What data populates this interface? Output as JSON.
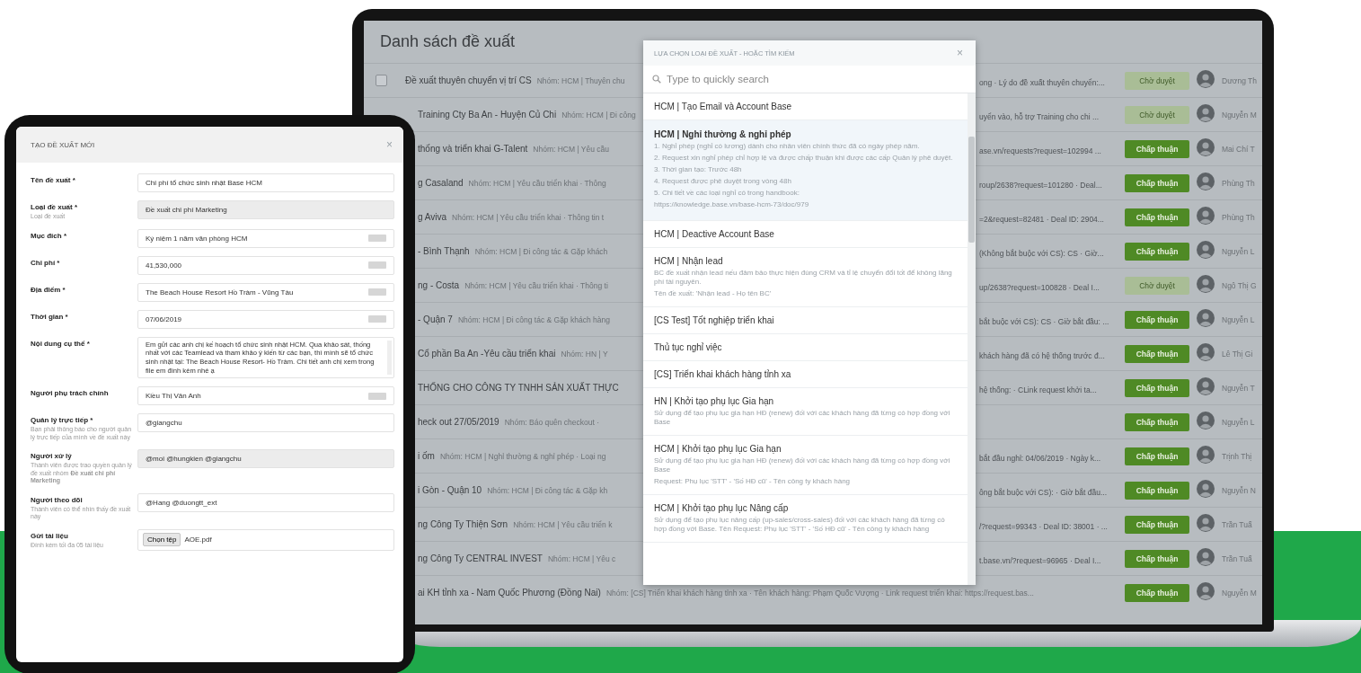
{
  "laptop": {
    "title": "Danh sách đề xuất",
    "rows": [
      {
        "checked": false,
        "title": "Đề xuất thuyên chuyển vị trí CS",
        "meta": "Nhóm: HCM | Thuyên chu",
        "detail": "ong · Lý do đề xuất thuyên chuyển:...",
        "kind": "pending",
        "status_label": "Chờ duyệt",
        "name": "Dương Th"
      },
      {
        "title": "Training Cty Ba An - Huyện Củ Chi",
        "meta": "Nhóm: HCM | Đi công",
        "detail": "uyển vào, hỗ trợ Training cho chi ...",
        "kind": "pending",
        "status_label": "Chờ duyệt",
        "name": "Nguyễn M"
      },
      {
        "title": "thống và triển khai G-Talent",
        "meta": "Nhóm: HCM | Yêu cầu",
        "detail": "ase.vn/requests?request=102994 ...",
        "kind": "approved",
        "status_label": "Chấp thuận",
        "name": "Mai Chí T"
      },
      {
        "title": "g Casaland",
        "meta": "Nhóm: HCM | Yêu cầu triển khai · Thông",
        "detail": "roup/2638?request=101280 · Deal...",
        "kind": "approved",
        "status_label": "Chấp thuận",
        "name": "Phùng Th"
      },
      {
        "title": "g Aviva",
        "meta": "Nhóm: HCM | Yêu cầu triển khai · Thông tin t",
        "detail": "=2&request=82481 · Deal ID: 2904...",
        "kind": "approved",
        "status_label": "Chấp thuận",
        "name": "Phùng Th"
      },
      {
        "title": "- Bình Thạnh",
        "meta": "Nhóm: HCM | Đi công tác & Gặp khách",
        "detail": "(Không bắt buộc với CS): CS · Giờ...",
        "kind": "approved",
        "status_label": "Chấp thuận",
        "name": "Nguyễn L"
      },
      {
        "title": "ng - Costa",
        "meta": "Nhóm: HCM | Yêu cầu triển khai · Thông ti",
        "detail": "up/2638?request=100828 · Deal I...",
        "kind": "pending",
        "status_label": "Chờ duyệt",
        "name": "Ngô Thị G"
      },
      {
        "title": "- Quận 7",
        "meta": "Nhóm: HCM | Đi công tác & Gặp khách hàng",
        "detail": "bắt buộc với CS): CS · Giờ bắt đầu: ...",
        "kind": "approved",
        "status_label": "Chấp thuận",
        "name": "Nguyễn L"
      },
      {
        "title": "Cổ phần Ba An -Yêu cầu triển khai",
        "meta": "Nhóm: HN | Y",
        "detail": "khách hàng đã có hệ thống trước đ...",
        "kind": "approved",
        "status_label": "Chấp thuận",
        "name": "Lê Thị Gi"
      },
      {
        "title": "THỐNG CHO CÔNG TY TNHH SẢN XUẤT THỰC",
        "detail": "hệ thống: · CLink request khởi ta...",
        "kind": "approved",
        "status_label": "Chấp thuận",
        "name": "Nguyễn T"
      },
      {
        "title": "heck out 27/05/2019",
        "meta": "Nhóm: Báo quên checkout ·",
        "kind": "approved",
        "status_label": "Chấp thuận",
        "name": "Nguyễn L"
      },
      {
        "title": "i ốm",
        "meta": "Nhóm: HCM | Nghỉ thường & nghỉ phép · Loại ng",
        "detail": "bắt đầu nghỉ: 04/06/2019 · Ngày k...",
        "kind": "approved",
        "status_label": "Chấp thuận",
        "name": "Trịnh Thị"
      },
      {
        "title": "i Gòn - Quận 10",
        "meta": "Nhóm: HCM | Đi công tác & Gặp kh",
        "detail": "ông bắt buộc với CS): · Giờ bắt đầu...",
        "kind": "approved",
        "status_label": "Chấp thuận",
        "name": "Nguyễn N"
      },
      {
        "title": "ng Công Ty Thiện Sơn",
        "meta": "Nhóm: HCM | Yêu cầu triển k",
        "detail": "/?request=99343 · Deal ID: 38001 · ...",
        "kind": "approved",
        "status_label": "Chấp thuận",
        "name": "Trần Tuấ"
      },
      {
        "title": "ng Công Ty CENTRAL INVEST",
        "meta": "Nhóm: HCM | Yêu c",
        "detail": "t.base.vn/?request=96965 · Deal I...",
        "kind": "approved",
        "status_label": "Chấp thuận",
        "name": "Trần Tuấ"
      },
      {
        "title": "ai KH tỉnh xa - Nam Quốc Phương (Đồng Nai)",
        "meta": "Nhóm: [CS] Triển khai khách hàng tỉnh xa · Tên khách hàng: Phạm Quốc Vượng · Link request triển khai: https://request.bas...",
        "kind": "approved",
        "status_label": "Chấp thuận",
        "name": "Nguyễn M"
      }
    ]
  },
  "modal": {
    "title": "LỰA CHỌN LOẠI ĐỀ XUẤT - HOẶC TÌM KIẾM",
    "close": "×",
    "search": {
      "placeholder": "Type to quickly search"
    },
    "items": [
      {
        "title": "HCM | Tạo Email và Account Base",
        "selected": false
      },
      {
        "title": "HCM | Nghỉ thường & nghỉ phép",
        "selected": true,
        "description": [
          "1. Nghỉ phép (nghỉ có lương) dành cho nhân viên chính thức đã có ngày phép năm.",
          "2. Request xin nghỉ phép chỉ hợp lệ và được chấp thuận khi được các cấp Quản lý phê duyệt.",
          "3. Thời gian tạo: Trước 48h",
          "4. Request được phê duyệt trong vòng 48h",
          "5. Chi tiết về các loại nghỉ có trong handbook:",
          "https://knowledge.base.vn/base-hcm-73/doc/979"
        ]
      },
      {
        "title": "HCM | Deactive Account Base",
        "selected": false
      },
      {
        "title": "HCM | Nhận lead",
        "selected": false,
        "description": [
          "BC đề xuất nhận lead nếu đảm bảo thực hiện đúng CRM và tỉ lệ chuyển đổi tốt để không lãng phí tài nguyên.",
          "Tên đề xuất: 'Nhận lead - Họ tên BC'"
        ]
      },
      {
        "title": "[CS Test] Tốt nghiệp triển khai",
        "selected": false
      },
      {
        "title": "Thủ tục nghỉ việc",
        "selected": false
      },
      {
        "title": "[CS] Triển khai khách hàng tỉnh xa",
        "selected": false
      },
      {
        "title": "HN | Khởi tạo phụ lục Gia hạn",
        "selected": false,
        "description": [
          "Sử dụng để tạo phụ lục gia hạn HĐ (renew) đối với các khách hàng đã từng có hợp đồng với Base"
        ]
      },
      {
        "title": "HCM | Khởi tạo phụ lục Gia hạn",
        "selected": false,
        "description": [
          "Sử dụng để tạo phụ lục gia hạn HĐ (renew) đối với các khách hàng đã từng có hợp đồng với Base",
          "Request: Phụ lục 'STT' - 'Số HĐ cũ' - Tên công ty khách hàng"
        ]
      },
      {
        "title": "HCM | Khởi tạo phụ lục Nâng cấp",
        "selected": false,
        "description": [
          "Sử dụng để tạo phụ lục nâng cấp (up-sales/cross-sales) đối với các khách hàng đã từng có hợp đồng với Base. Tên Request: Phụ lục 'STT' - 'Số HĐ cũ' - Tên công ty khách hàng"
        ]
      }
    ]
  },
  "tablet": {
    "title": "TẠO ĐỀ XUẤT MỚI",
    "close": "×",
    "fields": [
      {
        "label": "Tên đề xuất *",
        "kind": "text",
        "value": "Chi phí tổ chức sinh nhật Base HCM",
        "tag": false
      },
      {
        "label": "Loại đề xuất *",
        "hint": "Loại đề xuất",
        "kind": "disabled",
        "value": "Đề xuất chi phí Marketing",
        "tag": false
      },
      {
        "label": "Mục đích *",
        "kind": "text",
        "value": "Kỷ niệm 1 năm văn phòng HCM",
        "tag": true
      },
      {
        "label": "Chi phí *",
        "kind": "text",
        "value": "41,530,000",
        "tag": true
      },
      {
        "label": "Địa điểm *",
        "kind": "text",
        "value": "The Beach House Resort Hồ Tràm - Vũng Tàu",
        "tag": true
      },
      {
        "label": "Thời gian *",
        "kind": "text",
        "value": "07/06/2019",
        "tag": true
      },
      {
        "label": "Nội dung cụ thể *",
        "kind": "textarea",
        "value": "Em gửi các anh chị kế hoạch tổ chức sinh nhật HCM. Qua khảo sát, thống nhất với các Teamlead và tham khảo ý kiến từ các bạn, thì mình sẽ tổ chức sinh nhật tại: The Beach House Resort- Hồ Tràm. Chi tiết anh chị xem trong file em đính kèm nhé ạ",
        "tag": false
      },
      {
        "label": "Người phụ trách chính",
        "kind": "text",
        "value": "Kiều Thị Vân Anh",
        "tag": true
      },
      {
        "label": "Quản lý trực tiếp *",
        "hint": "Bạn phải thông báo cho người quản lý trực tiếp của mình về đề xuất này",
        "kind": "text",
        "value": "@giangchu",
        "tag": false
      },
      {
        "label": "Người xử lý",
        "hint": "Thành viên được trao quyền quản lý đề xuất nhóm **Đề xuất chi phí Marketing**",
        "kind": "disabled",
        "value": "@moi @hungkien @giangchu",
        "tag": false
      },
      {
        "label": "Người theo dõi",
        "hint": "Thành viên có thể nhìn thấy đề xuất này",
        "kind": "text",
        "value": "@Hang @duongtt_ext",
        "tag": false
      },
      {
        "label": "Gửi tài liệu",
        "hint": "Đính kèm tối đa 05 tài liệu",
        "kind": "file",
        "button": "Chọn tệp",
        "value": "AOE.pdf",
        "tag": false
      }
    ]
  }
}
